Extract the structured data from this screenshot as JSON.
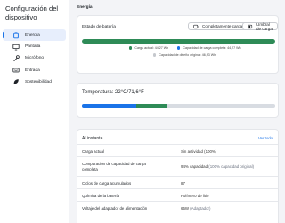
{
  "sidebar": {
    "title": "Configuración del dispositivo",
    "items": [
      {
        "label": "Energía",
        "icon": "power-icon",
        "active": true
      },
      {
        "label": "Pantalla",
        "icon": "monitor-icon",
        "active": false
      },
      {
        "label": "Micrófono",
        "icon": "microphone-icon",
        "active": false
      },
      {
        "label": "Entrada",
        "icon": "keyboard-icon",
        "active": false
      },
      {
        "label": "Sostenibilidad",
        "icon": "leaf-icon",
        "active": false
      }
    ]
  },
  "main": {
    "title": "Energía",
    "battery": {
      "label": "Estado de batería",
      "btn_full": "Completamente cargada",
      "btn_threshold": "Umbral de carga",
      "charge_fraction": 1.0,
      "legend": [
        {
          "text": "Carga actual: 44,27 Wh",
          "color": "#2e8b57"
        },
        {
          "text": "Capacidad de carga completa: 44,27 Wh",
          "color": "#1a73e8"
        },
        {
          "text": "Capacidad de diseño original: 46,93 Wh",
          "color": "#c5c8cd"
        }
      ]
    },
    "temperature": {
      "label": "Temperatura:  22°C/71,6°F",
      "segments": [
        {
          "color": "#1a73e8",
          "fraction": 0.28
        },
        {
          "color": "#2e8b57",
          "fraction": 0.16
        },
        {
          "color": "#d8dce2",
          "fraction": 0.56
        }
      ]
    },
    "details": {
      "heading": "Al instante",
      "link": "Ver todo",
      "rows": [
        {
          "key": "Carga actual",
          "value": "Sin actividad (100%)",
          "note": ""
        },
        {
          "key": "Comparación de capacidad de carga completa",
          "value": "94% capacidad",
          "note": "(100% capacidad original)"
        },
        {
          "key": "Ciclos de carga acumulados",
          "value": "87",
          "note": ""
        },
        {
          "key": "Química de la batería",
          "value": "Polímero de litio",
          "note": ""
        },
        {
          "key": "Voltaje del adaptador de alimentación",
          "value": "65W",
          "note": "(Adaptador)"
        }
      ]
    }
  }
}
